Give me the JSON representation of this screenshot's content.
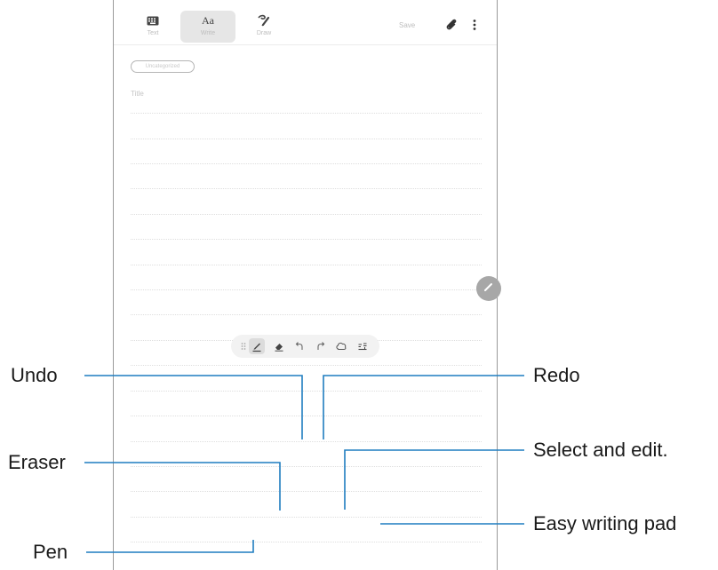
{
  "note_app": {
    "mode_tabs": [
      {
        "icon": "keyboard-icon",
        "label": "Text"
      },
      {
        "icon": "handwriting-icon",
        "glyph": "Aa",
        "label": "Write"
      },
      {
        "icon": "drawing-icon",
        "label": "Draw"
      }
    ],
    "save_label": "Save",
    "category_label": "Uncategorized",
    "title_placeholder": "Title"
  },
  "toolbar": {
    "buttons": [
      {
        "id": "drag-handle",
        "icon": "drag-handle-icon"
      },
      {
        "id": "pen",
        "icon": "pen-icon"
      },
      {
        "id": "eraser",
        "icon": "eraser-icon"
      },
      {
        "id": "undo",
        "icon": "undo-icon"
      },
      {
        "id": "redo",
        "icon": "redo-icon"
      },
      {
        "id": "select",
        "icon": "lasso-select-icon"
      },
      {
        "id": "easy-writing-pad",
        "icon": "writing-pad-icon"
      }
    ]
  },
  "callouts": {
    "undo": "Undo",
    "eraser": "Eraser",
    "pen": "Pen",
    "redo": "Redo",
    "select": "Select and edit.",
    "pad": "Easy writing pad"
  },
  "colors": {
    "leader_line": "#1f7dc0",
    "frame": "#9a9a9a",
    "fab": "#a7a7a7",
    "toolbar_bg": "#f2f2f2"
  }
}
